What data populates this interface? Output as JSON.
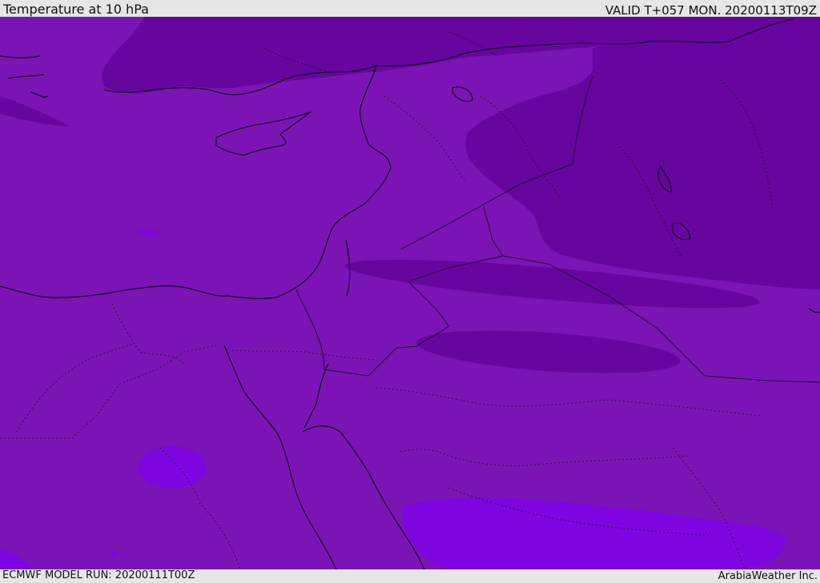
{
  "header": {
    "title": "Temperature at 10 hPa",
    "valid": "VALID T+057 MON. 20200113T09Z"
  },
  "footer": {
    "model_run": "ECMWF MODEL RUN: 20200111T00Z",
    "credit": "ArabiaWeather Inc."
  },
  "colors": {
    "background_band": "#7a14b4",
    "cold_band": "#66069e",
    "warm_band": "#7e05e0",
    "coastline": "#000000",
    "border": "#1a0a2a",
    "frame": "#e6e6e6"
  }
}
